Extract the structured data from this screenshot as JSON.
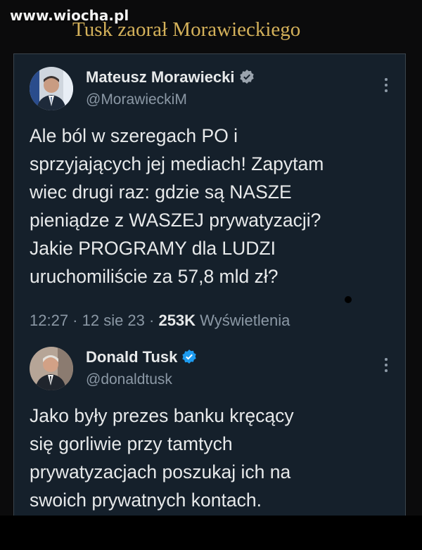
{
  "watermark": "www.wiocha.pl",
  "headline": "Tusk zaorał Morawieckiego",
  "tweets": [
    {
      "name": "Mateusz Morawiecki",
      "handle": "@MorawieckiM",
      "verified_icon": "verified-badge-icon",
      "text": "Ale ból w szeregach PO i\nsprzyjających jej mediach! Zapytam\nwiec drugi raz: gdzie są NASZE\npieniądze z WASZEJ prywatyzacji?\nJakie PROGRAMY dla LUDZI\nuruchomiliście za 57,8 mld zł?",
      "time": "12:27 · 12 sie 23 · ",
      "views": "253K",
      "views_label": " Wyświetlenia"
    },
    {
      "name": "Donald Tusk",
      "handle": "@donaldtusk",
      "verified_icon": "verified-badge-icon",
      "text": "Jako były prezes banku kręcący\nsię gorliwie przy tamtych\nprywatyzacjach poszukaj ich na\nswoich prywatnych kontach."
    }
  ],
  "colors": {
    "card_bg": "#15202b",
    "text": "#e7e9ea",
    "muted": "#8b98a5",
    "verified": "#1d9bf0",
    "headline": "#d4b15a"
  }
}
